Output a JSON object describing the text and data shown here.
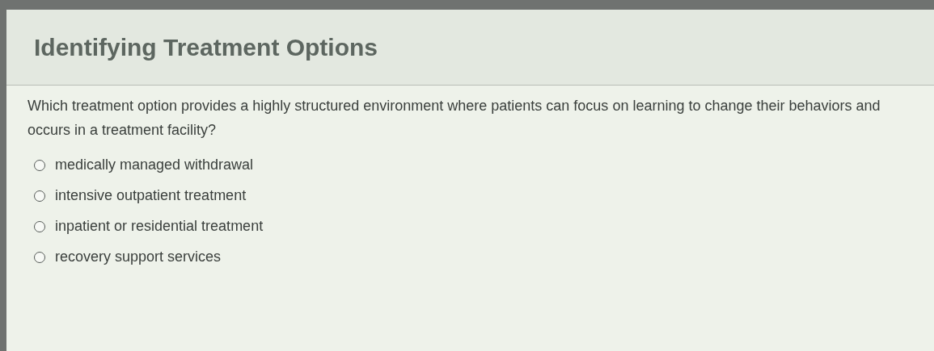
{
  "title": "Identifying Treatment Options",
  "question": "Which treatment option provides a highly structured environment where patients can focus on learning to change their behaviors and occurs in a treatment facility?",
  "options": [
    {
      "label": "medically managed withdrawal",
      "selected": false
    },
    {
      "label": "intensive outpatient treatment",
      "selected": false
    },
    {
      "label": "inpatient or residential treatment",
      "selected": false
    },
    {
      "label": "recovery support services",
      "selected": false
    }
  ]
}
